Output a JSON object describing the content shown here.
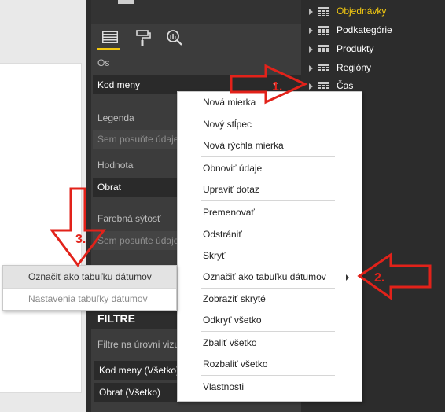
{
  "viz_pane": {
    "axis_label": "Os",
    "axis_value": "Kod meny",
    "legend_label": "Legenda",
    "legend_placeholder": "Sem posuňte údaje",
    "value_label": "Hodnota",
    "value_value": "Obrat",
    "color_label": "Farebná sýtosť",
    "color_placeholder": "Sem posuňte údaje",
    "filters_header": "FILTRE",
    "filter_level_label": "Filtre na úrovni vizu",
    "filter_1": "Kod meny (Všetko)",
    "filter_2": "Obrat (Všetko)"
  },
  "fields": [
    {
      "label": "Objednávky",
      "active": true
    },
    {
      "label": "Podkategórie",
      "active": false
    },
    {
      "label": "Produkty",
      "active": false
    },
    {
      "label": "Regióny",
      "active": false
    },
    {
      "label": "Čas",
      "active": false
    }
  ],
  "context_menu": {
    "items": [
      "Nová mierka",
      "Nový stĺpec",
      "Nová rýchla mierka",
      "Obnoviť údaje",
      "Upraviť dotaz",
      "Premenovať",
      "Odstrániť",
      "Skryť",
      "Označiť ako tabuľku dátumov",
      "Zobraziť skryté",
      "Odkryť všetko",
      "Zbaliť všetko",
      "Rozbaliť všetko",
      "Vlastnosti"
    ]
  },
  "sub_menu": {
    "item_1": "Označiť ako tabuľku dátumov",
    "item_2": "Nastavenia tabuľky dátumov"
  },
  "annotations": {
    "step1": "1.",
    "step2": "2.",
    "step3": "3."
  },
  "colors": {
    "accent": "#f2c811",
    "arrow": "#e2221a"
  }
}
